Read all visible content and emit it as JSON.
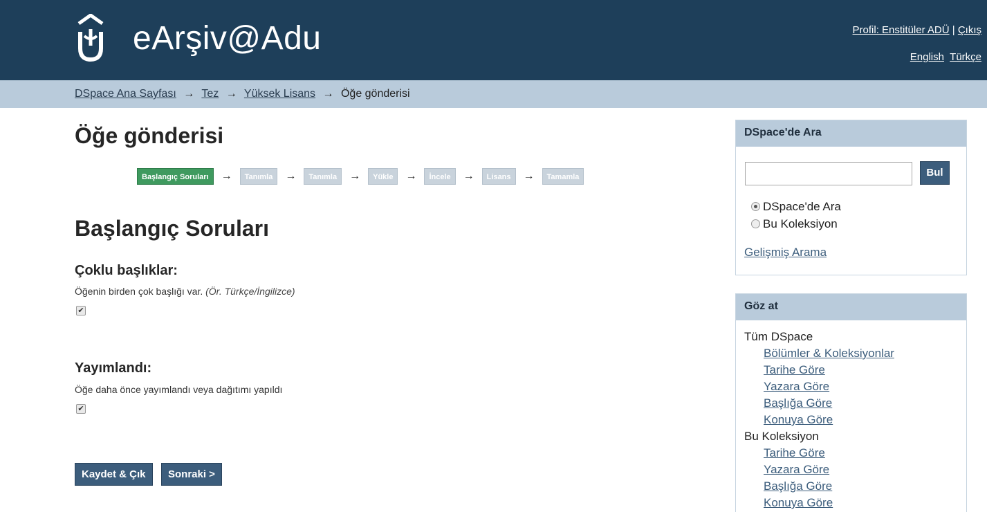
{
  "header": {
    "site_title": "eArşiv@Adu",
    "profile_link": "Profil: Enstitüler ADÜ",
    "separator": "|",
    "logout_link": "Çıkış",
    "lang_english": "English",
    "lang_turkish": "Türkçe"
  },
  "breadcrumb": {
    "items": [
      "DSpace Ana Sayfası",
      "Tez",
      "Yüksek Lisans"
    ],
    "current": "Öğe gönderisi",
    "arrow": "→"
  },
  "main": {
    "page_title": "Öğe gönderisi",
    "progress_steps": [
      "Başlangıç Soruları",
      "Tanımla",
      "Tanımla",
      "Yükle",
      "İncele",
      "Lisans",
      "Tamamla"
    ],
    "progress_current_index": 0,
    "section_title": "Başlangıç Soruları",
    "questions": [
      {
        "title": "Çoklu başlıklar:",
        "help": "Öğenin birden çok başlığı var.",
        "help_example": "(Ör. Türkçe/İngilizce)",
        "checked": true
      },
      {
        "title": "Yayımlandı:",
        "help": "Öğe daha önce yayımlandı veya dağıtımı yapıldı",
        "checked": true
      }
    ],
    "buttons": {
      "save_exit": "Kaydet & Çık",
      "next": "Sonraki >"
    }
  },
  "sidebar": {
    "search": {
      "title": "DSpace'de Ara",
      "input_value": "",
      "button": "Bul",
      "radio_all": "DSpace'de Ara",
      "radio_collection": "Bu Koleksiyon",
      "radio_selected": "all",
      "advanced_link": "Gelişmiş Arama"
    },
    "browse": {
      "title": "Göz at",
      "group_all": "Tüm DSpace",
      "all_links": [
        "Bölümler & Koleksiyonlar",
        "Tarihe Göre",
        "Yazara Göre",
        "Başlığa Göre",
        "Konuya Göre"
      ],
      "group_collection": "Bu Koleksiyon",
      "collection_links": [
        "Tarihe Göre",
        "Yazara Göre",
        "Başlığa Göre",
        "Konuya Göre"
      ]
    }
  },
  "colors": {
    "header_bg": "#1e3f5a",
    "breadcrumb_bg": "#b9cbdb",
    "current_step": "#3f9a5f",
    "button_bg": "#3c5d7c"
  }
}
